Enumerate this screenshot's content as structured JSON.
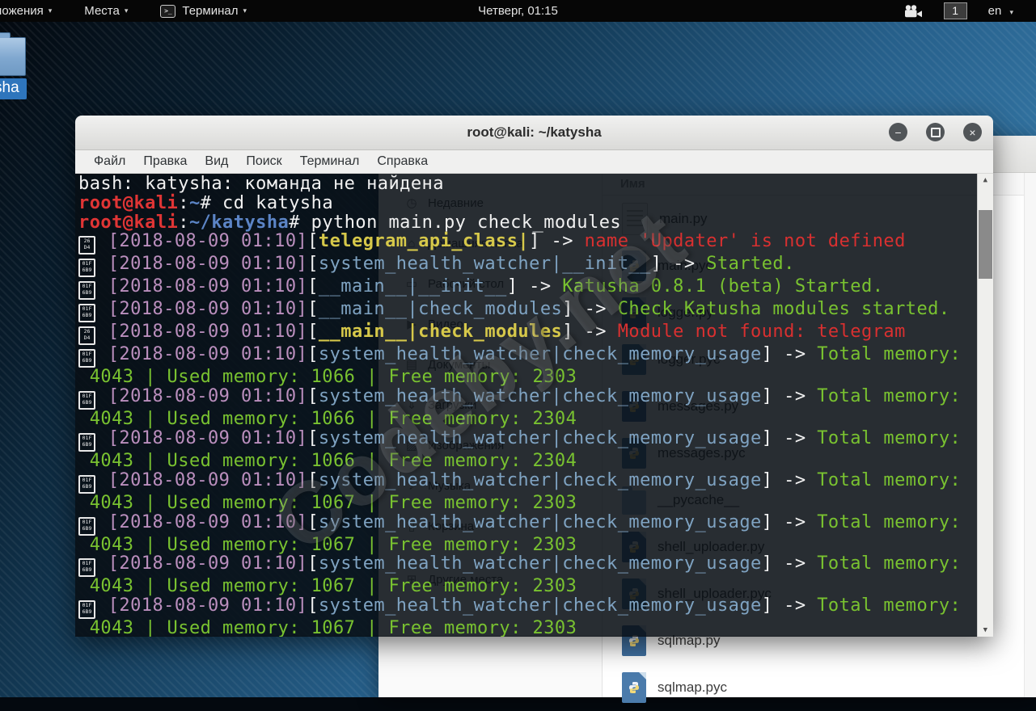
{
  "panel": {
    "applications_label": "Приложения",
    "places_label": "Места",
    "terminal_menu_label": "Терминал",
    "terminal_glyph": ">_",
    "clock": "Четверг, 01:15",
    "workspace": "1",
    "keyboard_layout": "en"
  },
  "desktop": {
    "selected_icon_label": "sha"
  },
  "terminal_window": {
    "title": "root@kali: ~/katysha",
    "menu": [
      "Файл",
      "Правка",
      "Вид",
      "Поиск",
      "Терминал",
      "Справка"
    ],
    "lines": [
      [
        [
          "w",
          "bash: katysha: команда не найдена"
        ]
      ],
      [
        [
          "r",
          "root@kali"
        ],
        [
          "w",
          ":"
        ],
        [
          "b",
          "~"
        ],
        [
          "w",
          "# cd katysha"
        ]
      ],
      [
        [
          "r",
          "root@kali"
        ],
        [
          "w",
          ":"
        ],
        [
          "b",
          "~/katysha"
        ],
        [
          "w",
          "# python main.py check_modules"
        ]
      ],
      [
        [
          "t26",
          "26|D4"
        ],
        [
          "p",
          " [2018-08-09 01:10]"
        ],
        [
          "w",
          "["
        ],
        [
          "y",
          "telegram_api_class|"
        ],
        [
          "w",
          "] -> "
        ],
        [
          "e",
          "name 'Updater' is not defined"
        ]
      ],
      [
        [
          "t1f",
          "01F|6B9"
        ],
        [
          "p",
          " [2018-08-09 01:10]"
        ],
        [
          "w",
          "["
        ],
        [
          "m",
          "system_health_watcher|__init__"
        ],
        [
          "w",
          "] -> "
        ],
        [
          "g",
          "Started."
        ]
      ],
      [
        [
          "t1f",
          "01F|6B9"
        ],
        [
          "p",
          " [2018-08-09 01:10]"
        ],
        [
          "w",
          "["
        ],
        [
          "m",
          "__main__|__init__"
        ],
        [
          "w",
          "] -> "
        ],
        [
          "g",
          "Katusha 0.8.1 (beta) Started."
        ]
      ],
      [
        [
          "t1f",
          "01F|6B9"
        ],
        [
          "p",
          " [2018-08-09 01:10]"
        ],
        [
          "w",
          "["
        ],
        [
          "m",
          "__main__|check_modules"
        ],
        [
          "w",
          "] -> "
        ],
        [
          "g",
          "Check Katusha modules started."
        ]
      ],
      [
        [
          "t26",
          "26|D4"
        ],
        [
          "p",
          " [2018-08-09 01:10]"
        ],
        [
          "w",
          "["
        ],
        [
          "y",
          "__main__|check_modules"
        ],
        [
          "w",
          "] -> "
        ],
        [
          "e",
          "Module not found: telegram"
        ]
      ],
      [
        [
          "t1f",
          "01F|6B9"
        ],
        [
          "p",
          " [2018-08-09 01:10]"
        ],
        [
          "w",
          "["
        ],
        [
          "m",
          "system_health_watcher|check_memory_usage"
        ],
        [
          "w",
          "] -> "
        ],
        [
          "g",
          "Total memory:"
        ]
      ],
      [
        [
          "g",
          " 4043 | Used memory: 1066 | Free memory: 2303"
        ]
      ],
      [
        [
          "t1f",
          "01F|6B9"
        ],
        [
          "p",
          " [2018-08-09 01:10]"
        ],
        [
          "w",
          "["
        ],
        [
          "m",
          "system_health_watcher|check_memory_usage"
        ],
        [
          "w",
          "] -> "
        ],
        [
          "g",
          "Total memory:"
        ]
      ],
      [
        [
          "g",
          " 4043 | Used memory: 1066 | Free memory: 2304"
        ]
      ],
      [
        [
          "t1f",
          "01F|6B9"
        ],
        [
          "p",
          " [2018-08-09 01:10]"
        ],
        [
          "w",
          "["
        ],
        [
          "m",
          "system_health_watcher|check_memory_usage"
        ],
        [
          "w",
          "] -> "
        ],
        [
          "g",
          "Total memory:"
        ]
      ],
      [
        [
          "g",
          " 4043 | Used memory: 1066 | Free memory: 2304"
        ]
      ],
      [
        [
          "t1f",
          "01F|6B9"
        ],
        [
          "p",
          " [2018-08-09 01:10]"
        ],
        [
          "w",
          "["
        ],
        [
          "m",
          "system_health_watcher|check_memory_usage"
        ],
        [
          "w",
          "] -> "
        ],
        [
          "g",
          "Total memory:"
        ]
      ],
      [
        [
          "g",
          " 4043 | Used memory: 1067 | Free memory: 2303"
        ]
      ],
      [
        [
          "t1f",
          "01F|6B9"
        ],
        [
          "p",
          " [2018-08-09 01:10]"
        ],
        [
          "w",
          "["
        ],
        [
          "m",
          "system_health_watcher|check_memory_usage"
        ],
        [
          "w",
          "] -> "
        ],
        [
          "g",
          "Total memory:"
        ]
      ],
      [
        [
          "g",
          " 4043 | Used memory: 1067 | Free memory: 2303"
        ]
      ],
      [
        [
          "t1f",
          "01F|6B9"
        ],
        [
          "p",
          " [2018-08-09 01:10]"
        ],
        [
          "w",
          "["
        ],
        [
          "m",
          "system_health_watcher|check_memory_usage"
        ],
        [
          "w",
          "] -> "
        ],
        [
          "g",
          "Total memory:"
        ]
      ],
      [
        [
          "g",
          " 4043 | Used memory: 1067 | Free memory: 2303"
        ]
      ],
      [
        [
          "t1f",
          "01F|6B9"
        ],
        [
          "p",
          " [2018-08-09 01:10]"
        ],
        [
          "w",
          "["
        ],
        [
          "m",
          "system_health_watcher|check_memory_usage"
        ],
        [
          "w",
          "] -> "
        ],
        [
          "g",
          "Total memory:"
        ]
      ],
      [
        [
          "g",
          " 4043 | Used memory: 1067 | Free memory: 2303"
        ]
      ],
      [
        [
          "t1f",
          "01F|6B9"
        ],
        [
          "p",
          " [2018-08-09 01:10]"
        ],
        [
          "w",
          "["
        ],
        [
          "m",
          "system_health_watcher|check_memory_usage"
        ],
        [
          "w",
          "] -> "
        ],
        [
          "g",
          "Total memory:"
        ]
      ],
      [
        [
          "g",
          " 4043 | Used memory: 1067 | Free memory: 2303"
        ]
      ]
    ]
  },
  "file_manager": {
    "column_header": "Имя",
    "sidebar": [
      {
        "icon": "recent-icon",
        "glyph": "◷",
        "label": "Недавние"
      },
      {
        "icon": "home-icon",
        "glyph": "⌂",
        "label": "Домашняя папка"
      },
      {
        "icon": "desktop-icon",
        "glyph": "▭",
        "label": "Рабочий стол"
      },
      {
        "icon": "video-icon",
        "glyph": "▶",
        "label": "Видео"
      },
      {
        "icon": "documents-icon",
        "glyph": "▤",
        "label": "Документы"
      },
      {
        "icon": "downloads-icon",
        "glyph": "⇓",
        "label": "Загрузки"
      },
      {
        "icon": "pictures-icon",
        "glyph": "▨",
        "label": "Изображения"
      },
      {
        "icon": "music-icon",
        "glyph": "♪",
        "label": "Музыка"
      },
      {
        "icon": "trash-icon",
        "glyph": "▯",
        "label": "Корзина"
      },
      {
        "icon": "other-places-icon",
        "glyph": "⊞",
        "label": "Другие места",
        "sep": true
      }
    ],
    "files": [
      {
        "type": "text",
        "label": "main.py"
      },
      {
        "type": "pyc",
        "label": "main.pyc"
      },
      {
        "type": "py",
        "label": "logger.py"
      },
      {
        "type": "pyc",
        "label": "logger.pyc"
      },
      {
        "type": "py",
        "label": "messages.py"
      },
      {
        "type": "pyc",
        "label": "messages.pyc"
      },
      {
        "type": "folder",
        "label": "__pycache__"
      },
      {
        "type": "py",
        "label": "shell_uploader.py"
      },
      {
        "type": "pyc",
        "label": "shell_uploader.pyc"
      },
      {
        "type": "py",
        "label": "sqlmap.py"
      },
      {
        "type": "pyc",
        "label": "sqlmap.pyc"
      }
    ]
  },
  "watermark": "Codeby.net"
}
